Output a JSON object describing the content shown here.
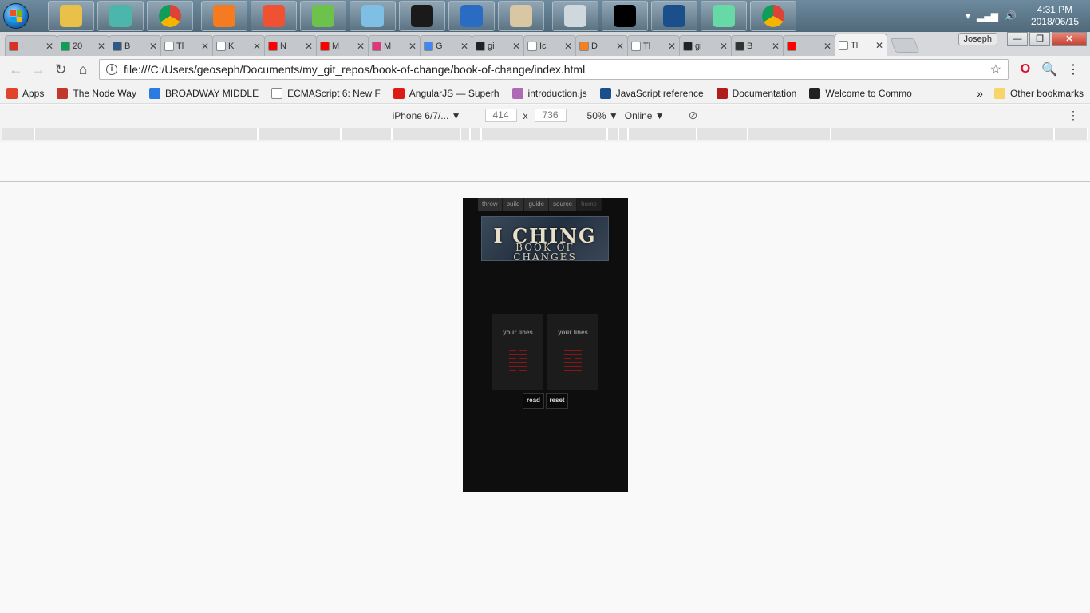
{
  "taskbar": {
    "apps": [
      {
        "name": "file-explorer-icon",
        "color": "#e8c04a"
      },
      {
        "name": "gitkraken-icon",
        "color": "#4db6ac"
      },
      {
        "name": "chrome-icon",
        "color": "#4285f4"
      },
      {
        "name": "xampp-icon",
        "color": "#f47b20"
      },
      {
        "name": "git-icon",
        "color": "#f05133"
      },
      {
        "name": "node-icon",
        "color": "#6cc24a"
      },
      {
        "name": "notepad-icon",
        "color": "#7fbfe6"
      },
      {
        "name": "menorah-icon",
        "color": "#1a1a1a"
      },
      {
        "name": "powershell-icon",
        "color": "#2a6cc4"
      },
      {
        "name": "paint-icon",
        "color": "#d9c7a3"
      },
      {
        "name": "calculator-icon",
        "color": "#cfd8dc"
      },
      {
        "name": "cmd-icon",
        "color": "#000000"
      },
      {
        "name": "virtualbox-icon",
        "color": "#1b4f8c"
      },
      {
        "name": "atom-icon",
        "color": "#66d9a6"
      },
      {
        "name": "chrome-icon",
        "color": "#4285f4"
      }
    ],
    "clock_time": "4:31 PM",
    "clock_date": "2018/06/15"
  },
  "tabs": [
    {
      "title": "I",
      "fav": "#d93025"
    },
    {
      "title": "20",
      "fav": "#0f9d58"
    },
    {
      "title": "B",
      "fav": "#2b5b84"
    },
    {
      "title": "Tl",
      "fav": "#ffffff"
    },
    {
      "title": "K",
      "fav": "#ffffff"
    },
    {
      "title": "N",
      "fav": "#ff0000"
    },
    {
      "title": "M",
      "fav": "#ff0000"
    },
    {
      "title": "M",
      "fav": "#e2367c"
    },
    {
      "title": "G",
      "fav": "#4285f4"
    },
    {
      "title": "gi",
      "fav": "#222222"
    },
    {
      "title": "Ic",
      "fav": "#ffffff"
    },
    {
      "title": "D",
      "fav": "#f48024"
    },
    {
      "title": "Tl",
      "fav": "#ffffff"
    },
    {
      "title": "gi",
      "fav": "#222222"
    },
    {
      "title": "B",
      "fav": "#333333"
    },
    {
      "title": "",
      "fav": "#ff0000"
    },
    {
      "title": "Tl",
      "fav": "#ffffff"
    }
  ],
  "window": {
    "profile_name": "Joseph"
  },
  "omnibox": {
    "url": "file:///C:/Users/geoseph/Documents/my_git_repos/book-of-change/book-of-change/index.html"
  },
  "bookmarks": [
    {
      "label": "Apps",
      "fav": "#e0452c"
    },
    {
      "label": "The Node Way",
      "fav": "#c0392b"
    },
    {
      "label": "BROADWAY MIDDLE",
      "fav": "#2a7ae2"
    },
    {
      "label": "ECMAScript 6: New F",
      "fav": "#ffffff"
    },
    {
      "label": "AngularJS — Superh",
      "fav": "#dd1b16"
    },
    {
      "label": "introduction.js",
      "fav": "#b06ab3"
    },
    {
      "label": "JavaScript reference",
      "fav": "#1b4f8c"
    },
    {
      "label": "Documentation",
      "fav": "#b01c1c"
    },
    {
      "label": "Welcome to Commo",
      "fav": "#222222"
    }
  ],
  "bookmarks_other": "Other bookmarks",
  "device_toolbar": {
    "device": "iPhone 6/7/...",
    "width": "414",
    "height": "736",
    "zoom": "50%",
    "network": "Online"
  },
  "app": {
    "nav": [
      "throw",
      "build",
      "guide",
      "source",
      "home"
    ],
    "banner_title": "I CHING",
    "banner_subtitle": "BOOK OF CHANGES",
    "cards": [
      {
        "label": "your lines",
        "lines": [
          "split",
          "solid",
          "split",
          "solid",
          "solid",
          "split"
        ]
      },
      {
        "label": "your lines",
        "lines": [
          "solid",
          "solid",
          "split",
          "solid",
          "solid",
          "solid"
        ]
      }
    ],
    "read_label": "read",
    "reset_label": "reset"
  }
}
